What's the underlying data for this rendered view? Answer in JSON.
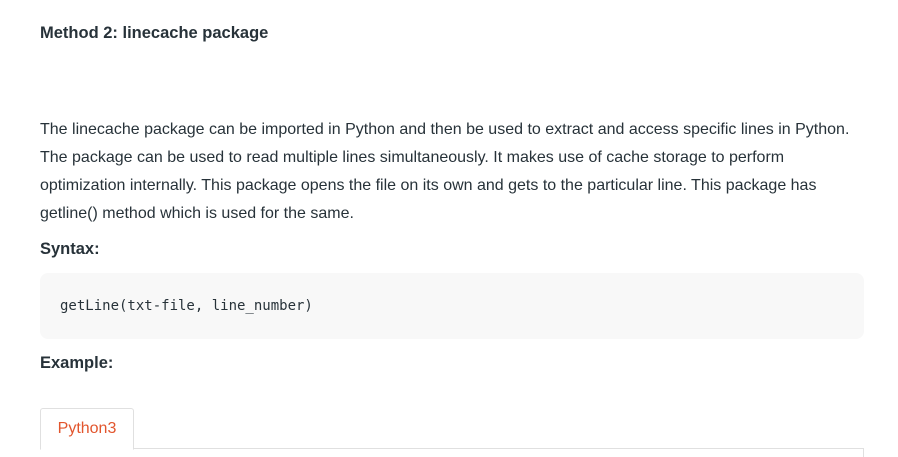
{
  "section": {
    "heading": "Method 2: linecache package",
    "paragraph": "The linecache package can be imported in Python and then be used to extract and access specific lines in Python. The package can be used to read multiple lines simultaneously. It makes use of cache storage to perform optimization internally. This package opens the file on its own and gets to the particular line. This package has getline() method which is used for the same.",
    "syntax_label": "Syntax:",
    "syntax_code": "getLine(txt-file, line_number)",
    "example_label": "Example:"
  },
  "tabs": [
    {
      "label": "Python3",
      "active": true
    }
  ],
  "colors": {
    "text": "#273239",
    "tab_active": "#e2552d",
    "code_bg": "#f8f8f8"
  }
}
